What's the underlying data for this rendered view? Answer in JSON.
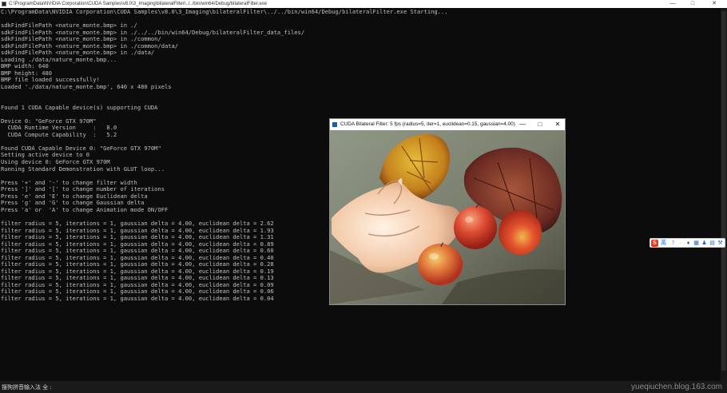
{
  "console_window": {
    "title": "C:\\ProgramData\\NVIDIA Corporation\\CUDA Samples\\v8.0\\3_Imaging\\bilateralFilter\\../../bin/win64/Debug/bilateralFilter.exe",
    "minimize": "—",
    "maximize": "□",
    "close": "✕"
  },
  "console_lines": [
    "C:\\ProgramData\\NVIDIA Corporation\\CUDA Samples\\v8.0\\3_Imaging\\bilateralFilter\\../../bin/win64/Debug/bilateralFilter.exe Starting...",
    "",
    "sdkFindFilePath <nature_monte.bmp> in ./",
    "sdkFindFilePath <nature_monte.bmp> in ./../../bin/win64/Debug/bilateralFilter_data_files/",
    "sdkFindFilePath <nature_monte.bmp> in ./common/",
    "sdkFindFilePath <nature_monte.bmp> in ./common/data/",
    "sdkFindFilePath <nature_monte.bmp> in ./data/",
    "Loading ./data/nature_monte.bmp...",
    "BMP width: 640",
    "BMP height: 480",
    "BMP file loaded successfully!",
    "Loaded './data/nature_monte.bmp', 640 x 480 pixels",
    "",
    "",
    "Found 1 CUDA Capable device(s) supporting CUDA",
    "",
    "Device 0: \"GeForce GTX 970M\"",
    "  CUDA Runtime Version     :   8.0",
    "  CUDA Compute Capability  :   5.2",
    "",
    "Found CUDA Capable Device 0: \"GeForce GTX 970M\"",
    "Setting active device to 0",
    "Using device 0: GeForce GTX 970M",
    "Running Standard Demonstration with GLUT loop...",
    "",
    "Press '+' and '-' to change filter width",
    "Press ']' and '[' to change number of iterations",
    "Press 'e' and 'E' to change Euclidean delta",
    "Press 'g' and 'G' to change Gaussian delta",
    "Press 'a' or  'A' to change Animation mode ON/OFF",
    "",
    "filter radius = 5, iterations = 1, gaussian delta = 4.00, euclidean delta = 2.62",
    "filter radius = 5, iterations = 1, gaussian delta = 4.00, euclidean delta = 1.93",
    "filter radius = 5, iterations = 1, gaussian delta = 4.00, euclidean delta = 1.31",
    "filter radius = 5, iterations = 1, gaussian delta = 4.00, euclidean delta = 0.89",
    "filter radius = 5, iterations = 1, gaussian delta = 4.00, euclidean delta = 0.60",
    "filter radius = 5, iterations = 1, gaussian delta = 4.00, euclidean delta = 0.40",
    "filter radius = 5, iterations = 1, gaussian delta = 4.00, euclidean delta = 0.28",
    "filter radius = 5, iterations = 1, gaussian delta = 4.00, euclidean delta = 0.19",
    "filter radius = 5, iterations = 1, gaussian delta = 4.00, euclidean delta = 0.13",
    "filter radius = 5, iterations = 1, gaussian delta = 4.00, euclidean delta = 0.09",
    "filter radius = 5, iterations = 1, gaussian delta = 4.00, euclidean delta = 0.06",
    "filter radius = 5, iterations = 1, gaussian delta = 4.00, euclidean delta = 0.04"
  ],
  "image_window": {
    "title": "CUDA Bilateral Filter:   5 fps (radius=5, iter=1, euclidean=0.15, gaussian=4.00)",
    "minimize": "—",
    "maximize": "□",
    "close": "✕"
  },
  "ime_toolbar": {
    "logo": "S",
    "mode": "英",
    "icons": [
      "moon-icon",
      "punctuation-icon",
      "mic-icon",
      "keyboard-icon",
      "skin-icon",
      "toolbox-icon",
      "wrench-icon"
    ],
    "glyphs": [
      "☽",
      "·",
      "♦",
      "▦",
      "♟",
      "▤",
      "⚒"
    ]
  },
  "status_bar": {
    "text": "搜狗拼音输入法 全 :"
  },
  "watermark": "yueqiuchen.blog.163.com",
  "colors": {
    "console_bg": "#0c0c0c",
    "console_text": "#c0c0c0",
    "ime_logo": "#e03a1e"
  }
}
